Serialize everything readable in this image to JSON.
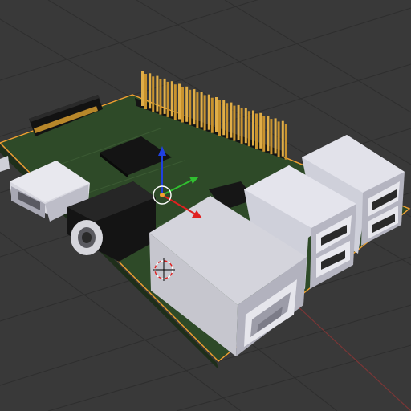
{
  "viewport": {
    "kind": "3d-viewport",
    "background_color": "#393939",
    "grid_line_color": "#2e2e2e",
    "selection_outline_color": "#f0a030"
  },
  "scene_object": {
    "name": "raspberry-pi-board",
    "pcb_color": "#2e4a28",
    "components": [
      "gpio-header-pins",
      "display-ribbon-connector",
      "soc-chip",
      "micro-usb-power-port",
      "audio-jack",
      "camera-connector",
      "usb-port-stack-front",
      "usb-port-stack-rear",
      "ethernet-port"
    ]
  },
  "transform_gizmo": {
    "x_axis_color": "#e02020",
    "y_axis_color": "#30c030",
    "z_axis_color": "#2040e0",
    "pivot_color": "#f0a030"
  },
  "cursor_3d": {
    "colors": [
      "#ffffff",
      "#e02020"
    ]
  }
}
